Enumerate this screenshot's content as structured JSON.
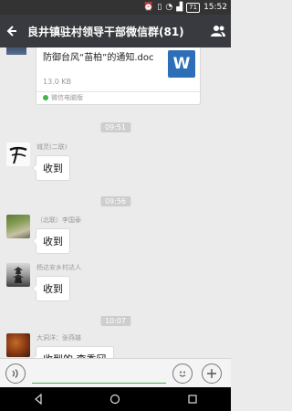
{
  "status_bar": {
    "icons": [
      "alarm-icon",
      "vibrate-icon",
      "signal-icon",
      "battery-icon"
    ],
    "battery": "71",
    "time": "15:52"
  },
  "header": {
    "back_icon": "back-arrow-icon",
    "title": "良井镇驻村领导干部微信群(81)",
    "profile_icon": "group-members-icon"
  },
  "file_message": {
    "name": "防御台风“苗柏”的通知.doc",
    "size": "13.0 KB",
    "icon_letter": "W",
    "source": "微信电脑版"
  },
  "messages": [
    {
      "time": "09:51",
      "sender": "城灵(二联)",
      "text": "收到",
      "avatar": "calligraphy-avatar"
    },
    {
      "time": "09:56",
      "sender": "（北联）李国泰",
      "text": "收到",
      "avatar": "landscape-avatar"
    },
    {
      "time": "",
      "sender": "杨达安乡村达人",
      "text": "收到",
      "avatar": "pagoda-avatar"
    },
    {
      "time": "10:07",
      "sender": "大洞洋：张燕雄",
      "text": "收到的,李秀冈",
      "avatar": "flower-avatar"
    }
  ],
  "input_bar": {
    "voice_icon": "voice-icon",
    "emoji_icon": "emoji-icon",
    "plus_icon": "plus-icon"
  },
  "nav_bar": {
    "back_icon": "nav-back-icon",
    "home_icon": "nav-home-icon",
    "recents_icon": "nav-recents-icon"
  },
  "colors": {
    "header_bg": "#393a3f",
    "chat_bg": "#ebebeb",
    "accent_green": "#44b549",
    "word_blue": "#2c6fb8"
  }
}
